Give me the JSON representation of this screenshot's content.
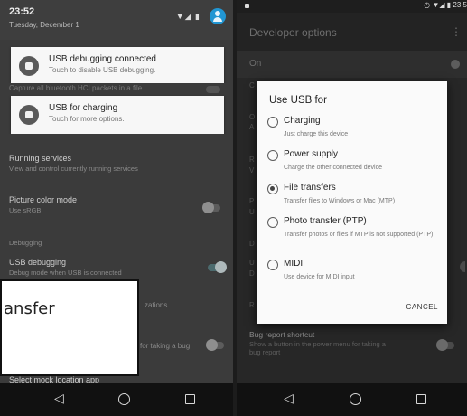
{
  "left": {
    "shade": {
      "time": "23:52",
      "date": "Tuesday, December 1",
      "icons": "▼◢ ▮"
    },
    "notifications": [
      {
        "title": "USB debugging connected",
        "text": "Touch to disable USB debugging."
      },
      {
        "title": "USB for charging",
        "text": "Touch for more options."
      }
    ],
    "peek_text": "Capture all bluetooth HCI packets in a file",
    "settings": {
      "running_services": {
        "title": "Running services",
        "sub": "View and control currently running services"
      },
      "picture_color_mode": {
        "title": "Picture color mode",
        "sub": "Use sRGB"
      },
      "debugging_label": "Debugging",
      "usb_debugging": {
        "title": "USB debugging",
        "sub": "Debug mode when USB is connected"
      },
      "partial_authorizations": "zations",
      "partial_bug": "for taking a bug",
      "mock_location": "Select mock location app"
    },
    "callout_text": "ansfer"
  },
  "right": {
    "status_icons": "◴ ▼◢ ▮ 23:5",
    "appbar_title": "Developer options",
    "menu_icon": "⋮",
    "on_label": "On",
    "bg_letters": [
      "C",
      "O",
      "A",
      "R",
      "V",
      "P",
      "U",
      "D",
      "U",
      "D",
      "R"
    ],
    "bug_report": {
      "title": "Bug report shortcut",
      "sub": "Show a button in the power menu for taking a bug report"
    },
    "mock_location": "Select mock location app",
    "dialog": {
      "title": "Use USB for",
      "options": [
        {
          "label": "Charging",
          "desc": "Just charge this device",
          "checked": false
        },
        {
          "label": "Power supply",
          "desc": "Charge the other connected device",
          "checked": false
        },
        {
          "label": "File transfers",
          "desc": "Transfer files to Windows or Mac (MTP)",
          "checked": true
        },
        {
          "label": "Photo transfer (PTP)",
          "desc": "Transfer photos or files if MTP is not supported (PTP)",
          "checked": false
        },
        {
          "label": "MIDI",
          "desc": "Use device for MIDI input",
          "checked": false
        }
      ],
      "cancel": "CANCEL"
    }
  },
  "nav": {
    "back_icon": "◁"
  }
}
